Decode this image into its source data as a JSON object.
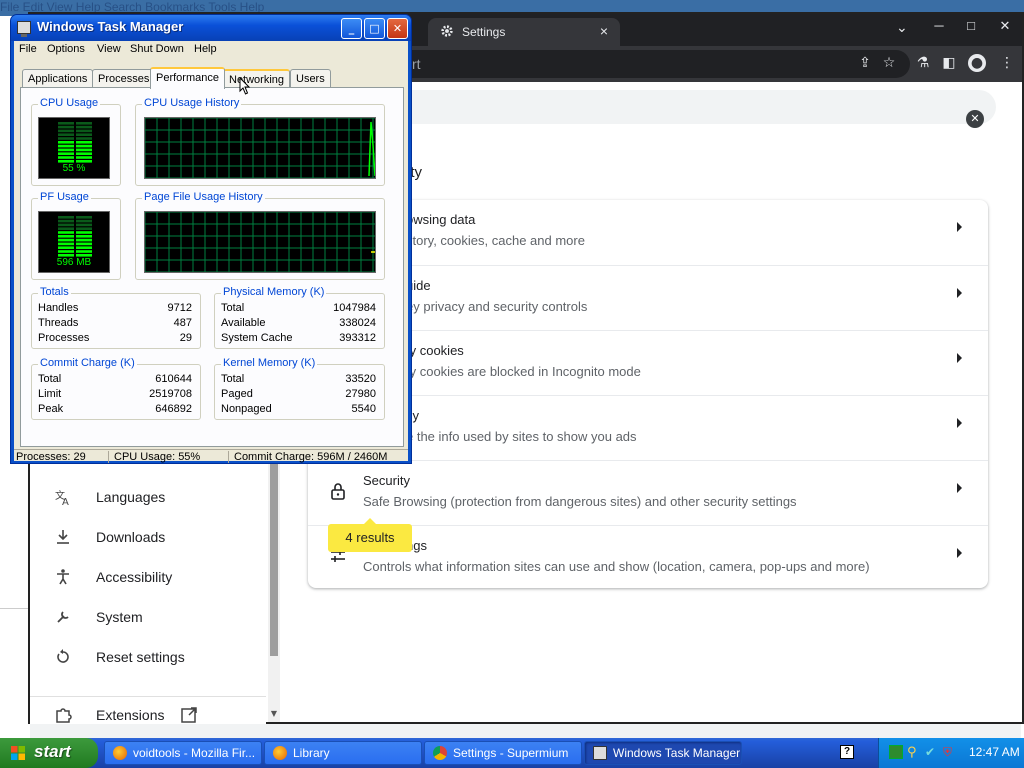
{
  "background_app_titles": "File  Edit  View  Help  Search  Bookmarks  Tools  Help",
  "chrome": {
    "tab": {
      "label": "Settings",
      "close": "×"
    },
    "window_controls": {
      "minimize": "─",
      "maximize": "□",
      "close": "✕"
    },
    "omnibox_text": "rt",
    "section_title": "rity",
    "rows": [
      {
        "title": "owsing data",
        "desc": "story, cookies, cache and more"
      },
      {
        "title": "uide",
        "desc": "ey privacy and security controls"
      },
      {
        "title": "ty cookies",
        "desc": "ty cookies are blocked in Incognito mode"
      },
      {
        "title": "cy",
        "desc": "e the info used by sites to show you ads"
      },
      {
        "title": "Security",
        "desc": "Safe Browsing (protection from dangerous sites) and other security settings",
        "icon": "lock-icon"
      },
      {
        "title": "ngs",
        "desc": "Controls what information sites can use and show (location, camera, pop-ups and more)",
        "icon": "sliders-icon"
      }
    ],
    "results_badge": "4 results",
    "nav": [
      {
        "label": "Languages",
        "icon": "translate-icon"
      },
      {
        "label": "Downloads",
        "icon": "download-icon"
      },
      {
        "label": "Accessibility",
        "icon": "accessibility-icon"
      },
      {
        "label": "System",
        "icon": "wrench-icon"
      },
      {
        "label": "Reset settings",
        "icon": "reset-icon"
      },
      {
        "label": "Extensions",
        "icon": "puzzle-icon"
      }
    ]
  },
  "task_manager": {
    "title": "Windows Task Manager",
    "menu": [
      "File",
      "Options",
      "View",
      "Shut Down",
      "Help"
    ],
    "tabs": [
      "Applications",
      "Processes",
      "Performance",
      "Networking",
      "Users"
    ],
    "active_tab": "Performance",
    "cpu_usage": {
      "label": "CPU Usage",
      "value": "55 %",
      "percent": 55
    },
    "cpu_history_label": "CPU Usage History",
    "pf_usage": {
      "label": "PF Usage",
      "value": "596 MB"
    },
    "pf_history_label": "Page File Usage History",
    "totals": {
      "label": "Totals",
      "rows": [
        {
          "k": "Handles",
          "v": "9712"
        },
        {
          "k": "Threads",
          "v": "487"
        },
        {
          "k": "Processes",
          "v": "29"
        }
      ]
    },
    "physical_memory": {
      "label": "Physical Memory (K)",
      "rows": [
        {
          "k": "Total",
          "v": "1047984"
        },
        {
          "k": "Available",
          "v": "338024"
        },
        {
          "k": "System Cache",
          "v": "393312"
        }
      ]
    },
    "commit_charge": {
      "label": "Commit Charge (K)",
      "rows": [
        {
          "k": "Total",
          "v": "610644"
        },
        {
          "k": "Limit",
          "v": "2519708"
        },
        {
          "k": "Peak",
          "v": "646892"
        }
      ]
    },
    "kernel_memory": {
      "label": "Kernel Memory (K)",
      "rows": [
        {
          "k": "Total",
          "v": "33520"
        },
        {
          "k": "Paged",
          "v": "27980"
        },
        {
          "k": "Nonpaged",
          "v": "5540"
        }
      ]
    },
    "status": {
      "processes": "Processes: 29",
      "cpu": "CPU Usage: 55%",
      "commit": "Commit Charge: 596M / 2460M"
    }
  },
  "taskbar": {
    "start_label": "start",
    "buttons": [
      {
        "label": "voidtools - Mozilla Fir...",
        "icon": "firefox-icon"
      },
      {
        "label": "Library",
        "icon": "firefox-icon"
      },
      {
        "label": "Settings - Supermium",
        "icon": "chromium-icon"
      },
      {
        "label": "Windows Task Manager",
        "icon": "task-manager-icon"
      }
    ],
    "clock": "12:47 AM"
  },
  "colors": {
    "xp_blue": "#0a50c8",
    "graph_green": "#00ff00",
    "grid_green": "#008040",
    "highlight_yellow": "#fbe941"
  }
}
